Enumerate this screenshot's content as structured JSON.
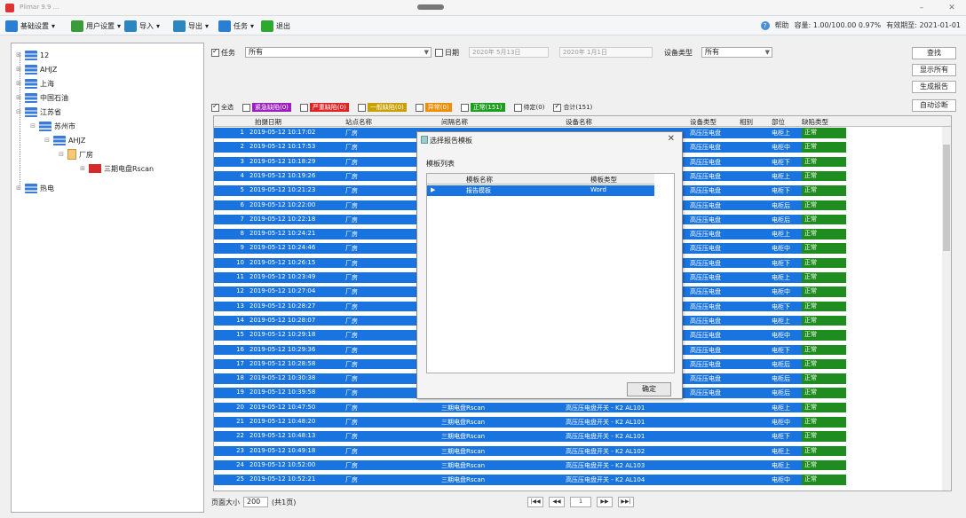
{
  "window": {
    "title": "Plimar 9.9 ..."
  },
  "menu": [
    {
      "label": "基础设置",
      "icon": "settings-icon",
      "color": "#2a7fd4"
    },
    {
      "label": "用户设置",
      "icon": "users-icon",
      "color": "#3b9b3b"
    },
    {
      "label": "导入",
      "icon": "import-icon",
      "color": "#2e86c1"
    },
    {
      "label": "导出",
      "icon": "export-icon",
      "color": "#2e86c1"
    },
    {
      "label": "任务",
      "icon": "task-icon",
      "color": "#2a7fd4"
    },
    {
      "label": "退出",
      "icon": "exit-icon",
      "color": "#2ea82e"
    }
  ],
  "status": {
    "help": "帮助",
    "storage": "容量: 1.00/100.00 0.97%",
    "expiry": "有效期至: 2021-01-01"
  },
  "tree": [
    {
      "label": "12",
      "level": 0,
      "type": "db"
    },
    {
      "label": "AHJZ",
      "level": 0,
      "type": "db"
    },
    {
      "label": "上海",
      "level": 0,
      "type": "db"
    },
    {
      "label": "中国石油",
      "level": 0,
      "type": "db"
    },
    {
      "label": "江苏省",
      "level": 0,
      "type": "db"
    },
    {
      "label": "苏州市",
      "level": 1,
      "type": "db"
    },
    {
      "label": "AHJZ",
      "level": 2,
      "type": "db"
    },
    {
      "label": "厂房",
      "level": 3,
      "type": "file"
    },
    {
      "label": "三期电盘Rscan",
      "level": 4,
      "type": "red"
    },
    {
      "label": "热电",
      "level": 0,
      "type": "db"
    }
  ],
  "filters": {
    "task_label": "任务",
    "task_value": "所有",
    "date_label": "日期",
    "date_from": "2020年 5月13日",
    "date_to": "2020年 1月1日",
    "device_type_label": "设备类型",
    "device_type_value": "所有"
  },
  "side_buttons": [
    "查找",
    "显示所有",
    "生成报告",
    "自动诊断"
  ],
  "legend": {
    "select_all": "全选",
    "items": [
      {
        "label": "紧急缺陷(0)",
        "color": "#9b1ebd"
      },
      {
        "label": "严重缺陷(0)",
        "color": "#e02424"
      },
      {
        "label": "一般缺陷(0)",
        "color": "#c8a000"
      },
      {
        "label": "异常(0)",
        "color": "#f08c00"
      },
      {
        "label": "正常(151)",
        "color": "#1e9e1e"
      }
    ],
    "pending": "待定(0)",
    "total": "合计(151)"
  },
  "grid": {
    "columns": [
      "拍摄日期",
      "站点名称",
      "间隔名称",
      "设备名称",
      "设备类型",
      "相别",
      "部位",
      "缺陷类型"
    ],
    "rows": [
      {
        "n": "1",
        "date": "2019-05-12 10:17:02",
        "site": "厂房",
        "bay": "",
        "dev": "",
        "type": "高压压电盘",
        "phase": "",
        "part": "电柜上",
        "result": "正常"
      },
      {
        "n": "2",
        "date": "2019-05-12 10:17:53",
        "site": "厂房",
        "bay": "",
        "dev": "",
        "type": "高压压电盘",
        "phase": "",
        "part": "电柜中",
        "result": "正常"
      },
      {
        "n": "3",
        "date": "2019-05-12 10:18:29",
        "site": "厂房",
        "bay": "",
        "dev": "",
        "type": "高压压电盘",
        "phase": "",
        "part": "电柜下",
        "result": "正常"
      },
      {
        "n": "4",
        "date": "2019-05-12 10:19:26",
        "site": "厂房",
        "bay": "",
        "dev": "",
        "type": "高压压电盘",
        "phase": "",
        "part": "电柜上",
        "result": "正常"
      },
      {
        "n": "5",
        "date": "2019-05-12 10:21:23",
        "site": "厂房",
        "bay": "",
        "dev": "",
        "type": "高压压电盘",
        "phase": "",
        "part": "电柜下",
        "result": "正常"
      },
      {
        "n": "6",
        "date": "2019-05-12 10:22:00",
        "site": "厂房",
        "bay": "",
        "dev": "",
        "type": "高压压电盘",
        "phase": "",
        "part": "电柜后",
        "result": "正常"
      },
      {
        "n": "7",
        "date": "2019-05-12 10:22:18",
        "site": "厂房",
        "bay": "",
        "dev": "",
        "type": "高压压电盘",
        "phase": "",
        "part": "电柜后",
        "result": "正常"
      },
      {
        "n": "8",
        "date": "2019-05-12 10:24:21",
        "site": "厂房",
        "bay": "",
        "dev": "",
        "type": "高压压电盘",
        "phase": "",
        "part": "电柜上",
        "result": "正常"
      },
      {
        "n": "9",
        "date": "2019-05-12 10:24:46",
        "site": "厂房",
        "bay": "",
        "dev": "",
        "type": "高压压电盘",
        "phase": "",
        "part": "电柜中",
        "result": "正常"
      },
      {
        "n": "10",
        "date": "2019-05-12 10:26:15",
        "site": "厂房",
        "bay": "",
        "dev": "",
        "type": "高压压电盘",
        "phase": "",
        "part": "电柜下",
        "result": "正常"
      },
      {
        "n": "11",
        "date": "2019-05-12 10:23:49",
        "site": "厂房",
        "bay": "",
        "dev": "",
        "type": "高压压电盘",
        "phase": "",
        "part": "电柜上",
        "result": "正常"
      },
      {
        "n": "12",
        "date": "2019-05-12 10:27:04",
        "site": "厂房",
        "bay": "",
        "dev": "",
        "type": "高压压电盘",
        "phase": "",
        "part": "电柜中",
        "result": "正常"
      },
      {
        "n": "13",
        "date": "2019-05-12 10:28:27",
        "site": "厂房",
        "bay": "",
        "dev": "",
        "type": "高压压电盘",
        "phase": "",
        "part": "电柜下",
        "result": "正常"
      },
      {
        "n": "14",
        "date": "2019-05-12 10:28:07",
        "site": "厂房",
        "bay": "",
        "dev": "",
        "type": "高压压电盘",
        "phase": "",
        "part": "电柜上",
        "result": "正常"
      },
      {
        "n": "15",
        "date": "2019-05-12 10:29:18",
        "site": "厂房",
        "bay": "",
        "dev": "",
        "type": "高压压电盘",
        "phase": "",
        "part": "电柜中",
        "result": "正常"
      },
      {
        "n": "16",
        "date": "2019-05-12 10:29:36",
        "site": "厂房",
        "bay": "",
        "dev": "",
        "type": "高压压电盘",
        "phase": "",
        "part": "电柜下",
        "result": "正常"
      },
      {
        "n": "17",
        "date": "2019-05-12 10:28:58",
        "site": "厂房",
        "bay": "",
        "dev": "",
        "type": "高压压电盘",
        "phase": "",
        "part": "电柜后",
        "result": "正常"
      },
      {
        "n": "18",
        "date": "2019-05-12 10:30:38",
        "site": "厂房",
        "bay": "",
        "dev": "",
        "type": "高压压电盘",
        "phase": "",
        "part": "电柜后",
        "result": "正常"
      },
      {
        "n": "19",
        "date": "2019-05-12 10:39:58",
        "site": "厂房",
        "bay": "",
        "dev": "",
        "type": "高压压电盘",
        "phase": "",
        "part": "电柜后",
        "result": "正常"
      },
      {
        "n": "20",
        "date": "2019-05-12 10:47:50",
        "site": "厂房",
        "bay": "三期电盘Rscan",
        "dev": "高压压电盘开关 - K2 AL101",
        "type": "",
        "phase": "",
        "part": "电柜上",
        "result": "正常"
      },
      {
        "n": "21",
        "date": "2019-05-12 10:48:20",
        "site": "厂房",
        "bay": "三期电盘Rscan",
        "dev": "高压压电盘开关 - K2 AL101",
        "type": "",
        "phase": "",
        "part": "电柜中",
        "result": "正常"
      },
      {
        "n": "22",
        "date": "2019-05-12 10:48:13",
        "site": "厂房",
        "bay": "三期电盘Rscan",
        "dev": "高压压电盘开关 - K2 AL101",
        "type": "",
        "phase": "",
        "part": "电柜下",
        "result": "正常"
      },
      {
        "n": "23",
        "date": "2019-05-12 10:49:18",
        "site": "厂房",
        "bay": "三期电盘Rscan",
        "dev": "高压压电盘开关 - K2 AL102",
        "type": "",
        "phase": "",
        "part": "电柜上",
        "result": "正常"
      },
      {
        "n": "24",
        "date": "2019-05-12 10:52:00",
        "site": "厂房",
        "bay": "三期电盘Rscan",
        "dev": "高压压电盘开关 - K2 AL103",
        "type": "",
        "phase": "",
        "part": "电柜上",
        "result": "正常"
      },
      {
        "n": "25",
        "date": "2019-05-12 10:52:21",
        "site": "厂房",
        "bay": "三期电盘Rscan",
        "dev": "高压压电盘开关 - K2 AL104",
        "type": "",
        "phase": "",
        "part": "电柜中",
        "result": "正常"
      }
    ]
  },
  "dialog": {
    "title": "选择报告模板",
    "list_label": "模板列表",
    "col_name": "模板名称",
    "col_type": "模板类型",
    "row_name": "报告模板",
    "row_type": "Word",
    "ok": "确定"
  },
  "footer": {
    "page_size_label": "页面大小",
    "page_size": "200",
    "total_pages": "(共1页)",
    "current_page": "1"
  },
  "colors": {
    "selection": "#1a74e0",
    "normal": "#1e8c1e"
  }
}
